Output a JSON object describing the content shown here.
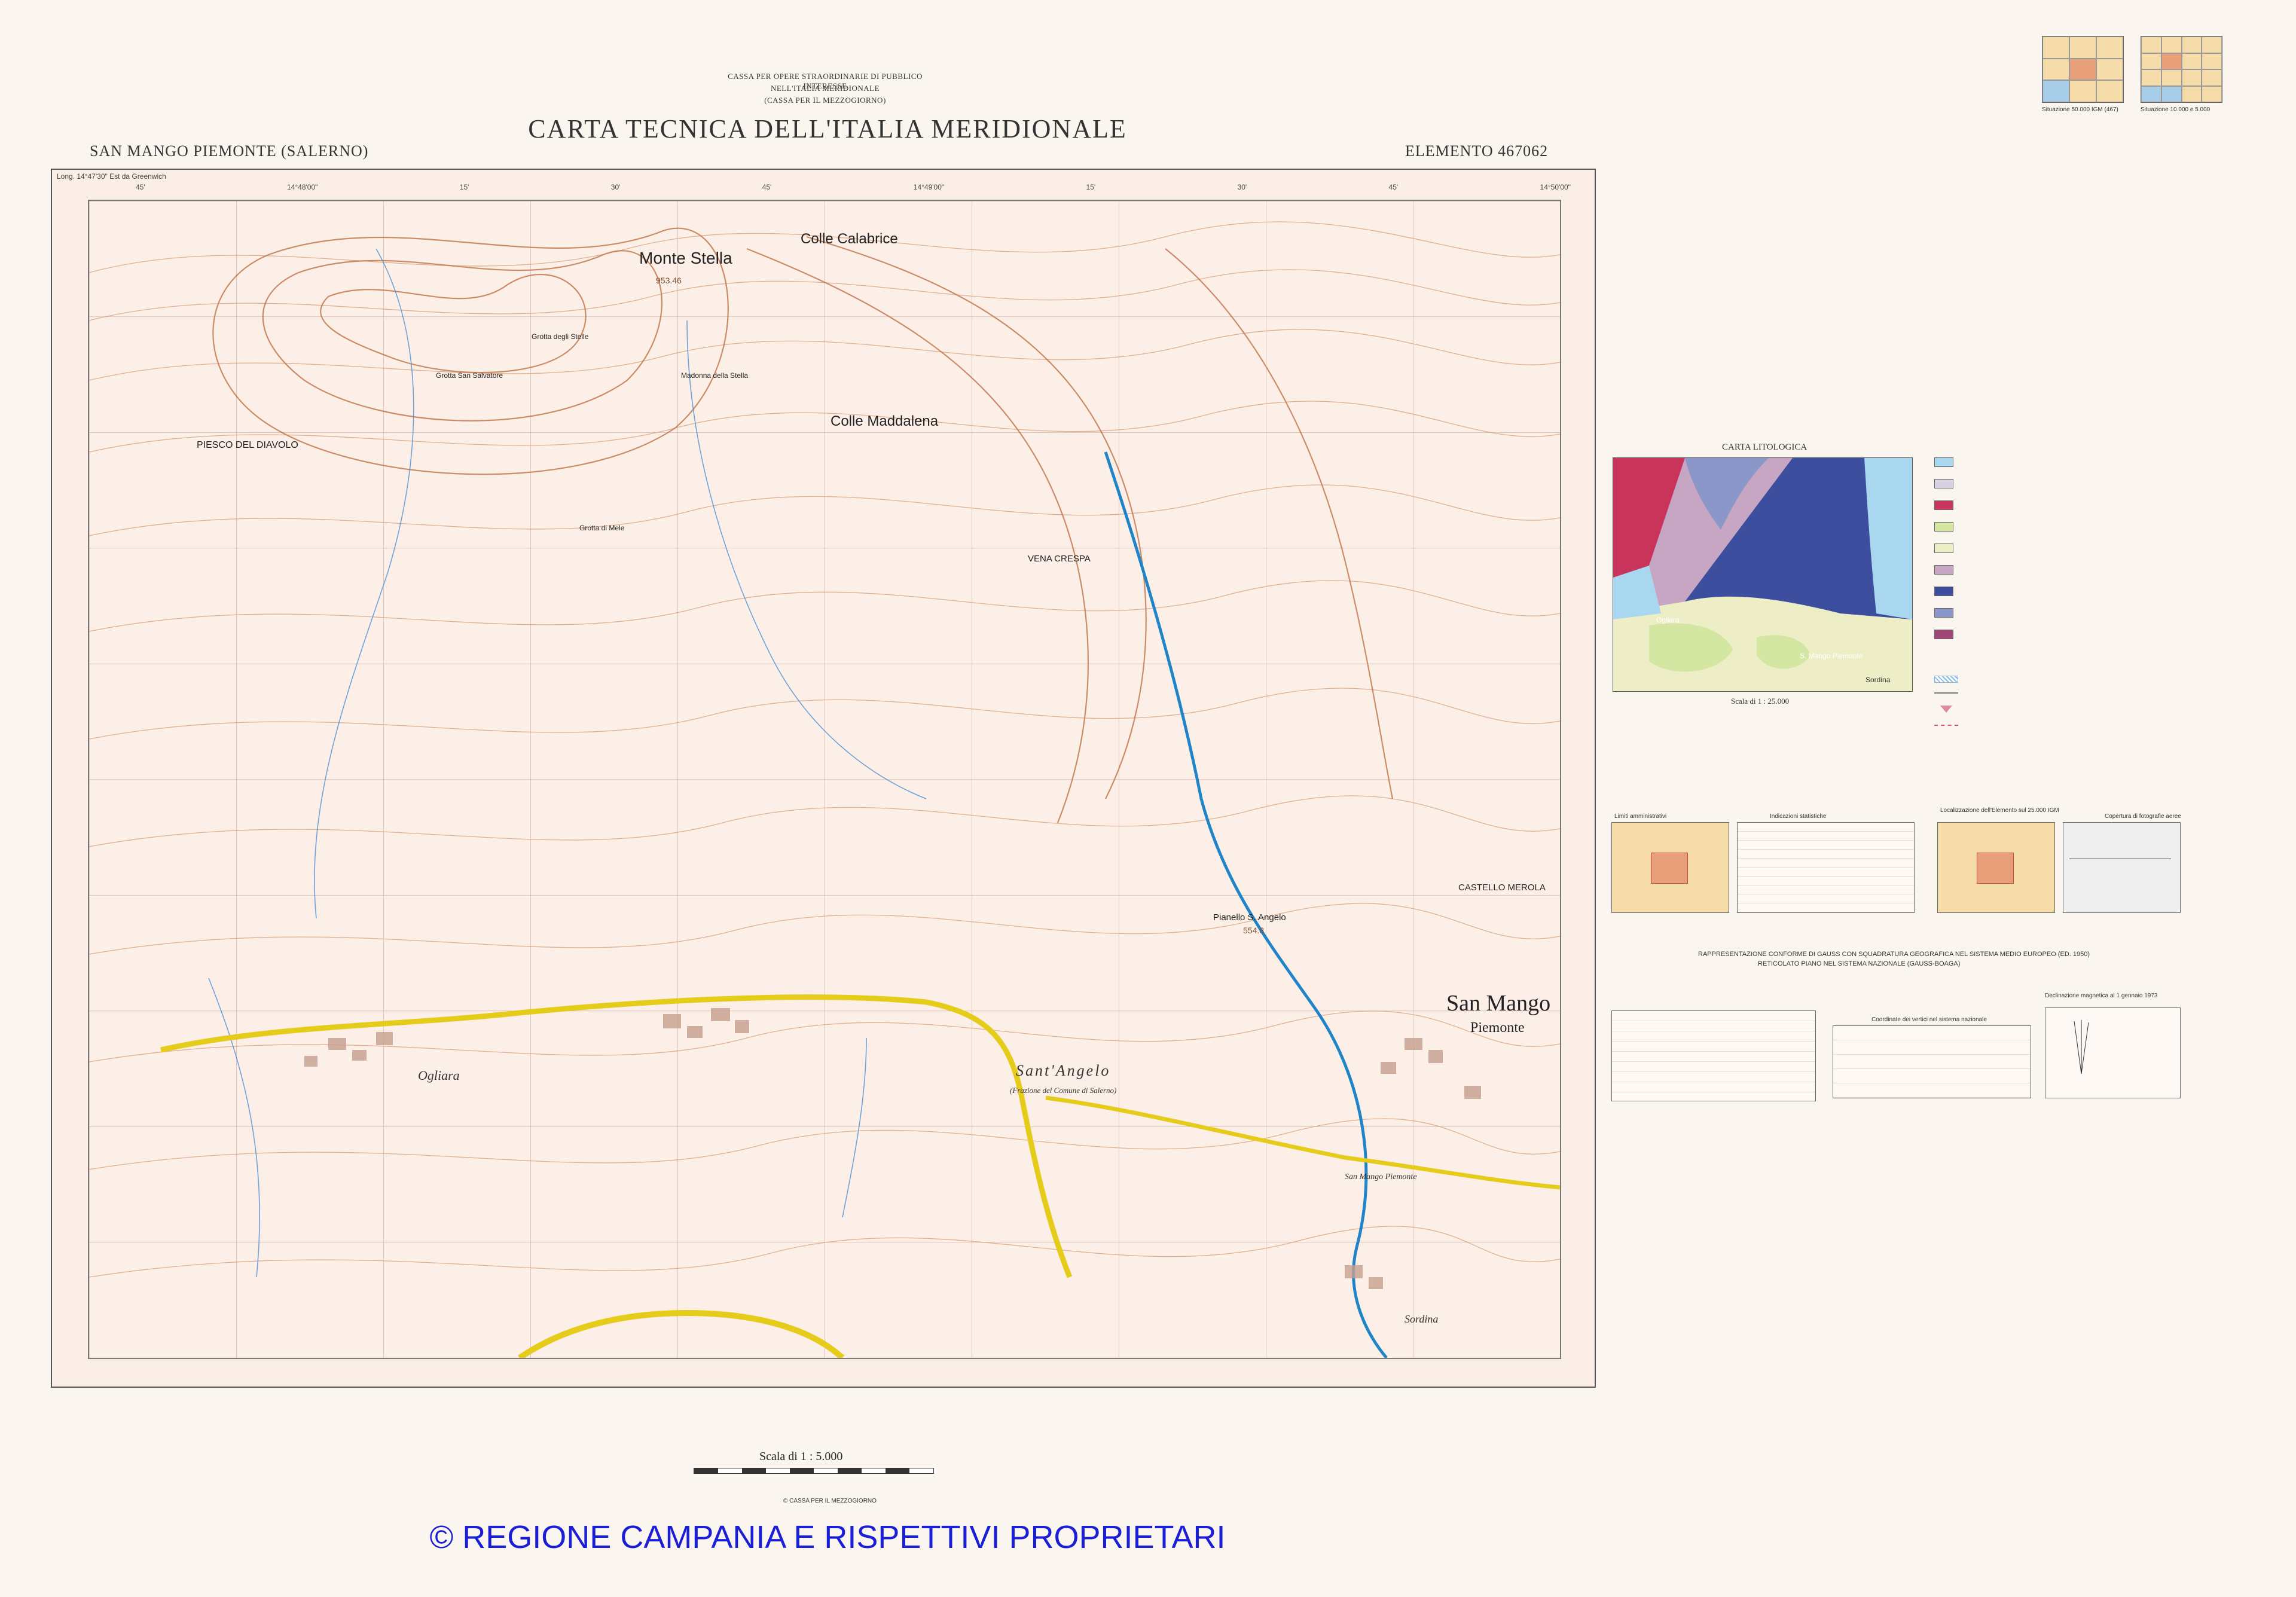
{
  "header": {
    "agency_line1": "CASSA PER OPERE STRAORDINARIE DI PUBBLICO INTERESSE",
    "agency_line2": "NELL'ITALIA MERIDIONALE",
    "agency_line3": "(CASSA PER IL MEZZOGIORNO)",
    "title": "CARTA TECNICA DELL'ITALIA MERIDIONALE",
    "sheet_name": "SAN MANGO PIEMONTE (SALERNO)",
    "element_code": "ELEMENTO 467062"
  },
  "map": {
    "top_left_label": "Long. 14°47'30\" Est da Greenwich",
    "coords_top": [
      "45'",
      "14°48'00\"",
      "15'",
      "30'",
      "45'",
      "14°49'00\"",
      "15'",
      "30'",
      "45'",
      "14°50'00\""
    ],
    "labels": {
      "monte_stella": "Monte Stella",
      "colle_calabrice": "Colle Calabrice",
      "colle_maddalena": "Colle Maddalena",
      "pesco_del_diavolo": "PIESCO DEL DIAVOLO",
      "vena_crespa": "VENA CRESPA",
      "castello_merola": "CASTELLO MEROLA",
      "pianello": "Pianello S. Angelo",
      "grotta_stelle": "Grotta degli Stelle",
      "grotta_salvatore": "Grotta San Salvatore",
      "madonna_stella": "Madonna della Stella",
      "grotta_mele": "Grotta di Mele",
      "ogliara": "Ogliara",
      "sant_angelo": "Sant'Angelo",
      "sant_angelo_sub": "(Frazione del Comune di Salerno)",
      "san_mango": "San Mango",
      "piemonte": "Piemonte",
      "san_mango_small": "San Mango Piemonte",
      "sordina": "Sordina",
      "monte_stella_height": "953.46",
      "pianello_height": "554.8"
    }
  },
  "footer": {
    "scale": "Scala di 1 : 5.000",
    "copyright": "© REGIONE CAMPANIA E RISPETTIVI PROPRIETARI",
    "cassa_small": "© CASSA PER IL MEZZOGIORNO"
  },
  "right_panels": {
    "index_caption_1": "Situazione 50.000 IGM (467)",
    "index_caption_2": "Situazione 10.000 e 5.000",
    "litho_title": "CARTA LITOLOGICA",
    "litho_scale": "Scala di 1 : 25.000",
    "litho_places": {
      "ogliara": "Ogliara",
      "s_mango": "S. Mango Piemonte",
      "sordina": "Sordina"
    },
    "legend_colors": [
      "#a9d7ef",
      "#d6d2e3",
      "#c8345c",
      "#d3e7a3",
      "#eeeec6",
      "#c7a6c4",
      "#3c4e9d",
      "#8a97c8",
      "#9e4576"
    ],
    "bottom_titles": {
      "limiti": "Limiti amministrativi",
      "indicazioni": "Indicazioni statistiche",
      "localizzazione": "Localizzazione dell'Elemento sul 25.000 IGM",
      "copertura": "Copertura di fotografie aeree"
    },
    "projection_line1": "RAPPRESENTAZIONE CONFORME DI GAUSS CON SQUADRATURA GEOGRAFICA NEL SISTEMA MEDIO EUROPEO (ED. 1950)",
    "projection_line2": "RETICOLATO PIANO NEL SISTEMA NAZIONALE (GAUSS-BOAGA)",
    "coord_table_title": "Coordinate dei vertici nel sistema nazionale",
    "declination_title": "Declinazione magnetica al 1 gennaio 1973"
  }
}
